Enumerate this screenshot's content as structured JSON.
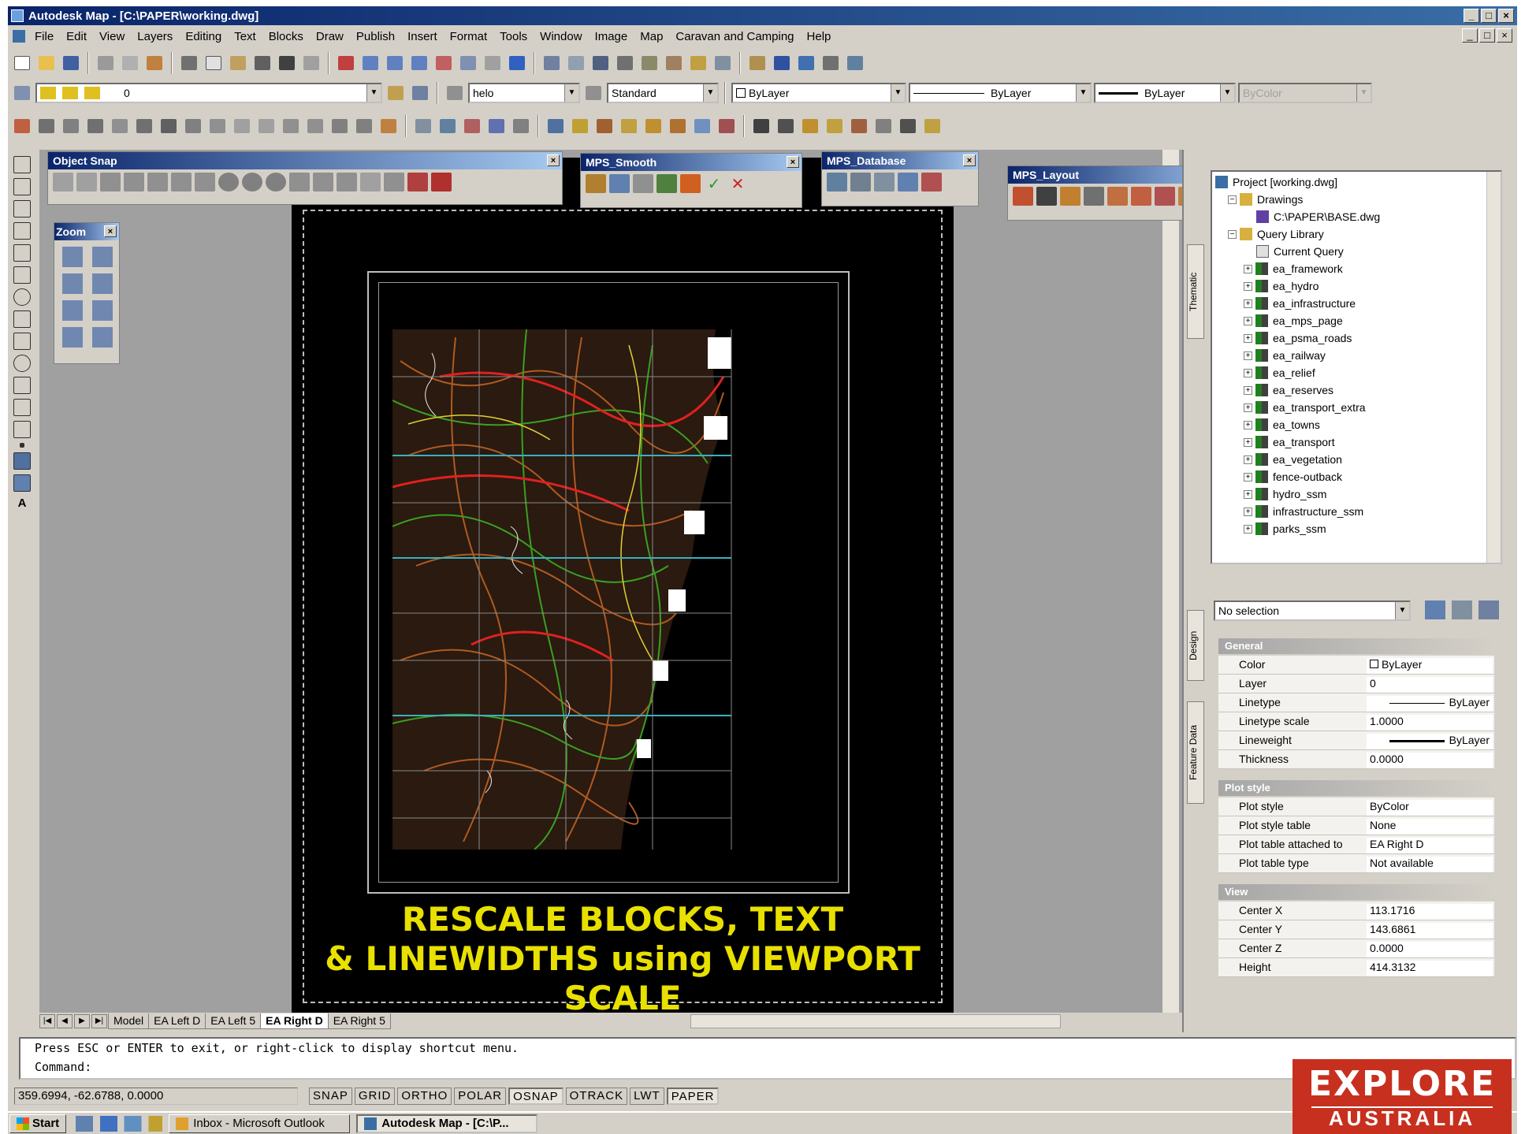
{
  "window": {
    "title": "Autodesk Map - [C:\\PAPER\\working.dwg]",
    "min": "_",
    "max": "□",
    "close": "×"
  },
  "menu": [
    "File",
    "Edit",
    "View",
    "Layers",
    "Editing",
    "Text",
    "Blocks",
    "Draw",
    "Publish",
    "Insert",
    "Format",
    "Tools",
    "Window",
    "Image",
    "Map",
    "Caravan and Camping",
    "Help"
  ],
  "layer_combo": "0",
  "text_style_combo": "helo",
  "dim_style_combo": "Standard",
  "color_combo": "ByLayer",
  "linetype_combo": "ByLayer",
  "lineweight_combo": "ByLayer",
  "plotstyle_combo": "ByColor",
  "palettes": {
    "object_snap": "Object Snap",
    "zoom": "Zoom",
    "smooth": "MPS_Smooth",
    "database": "MPS_Database",
    "layout": "MPS_Layout"
  },
  "slogan": [
    "RESCALE BLOCKS, TEXT",
    "& LINEWIDTHS using VIEWPORT",
    "SCALE"
  ],
  "layout_tabs": [
    "Model",
    "EA Left D",
    "EA Left 5",
    "EA Right D",
    "EA Right 5"
  ],
  "active_tab": "EA Right D",
  "workspace": {
    "vtab_thematic": "Thematic",
    "project": "Project [working.dwg]",
    "drawings": "Drawings",
    "drawing_file": "C:\\PAPER\\BASE.dwg",
    "query_library": "Query Library",
    "current_query": "Current Query",
    "queries": [
      "ea_framework",
      "ea_hydro",
      "ea_infrastructure",
      "ea_mps_page",
      "ea_psma_roads",
      "ea_railway",
      "ea_relief",
      "ea_reserves",
      "ea_transport_extra",
      "ea_towns",
      "ea_transport",
      "ea_vegetation",
      "fence-outback",
      "hydro_ssm",
      "infrastructure_ssm",
      "parks_ssm"
    ]
  },
  "properties": {
    "vtab_design": "Design",
    "vtab_feature": "Feature Data",
    "selection": "No selection",
    "general": "General",
    "general_rows": [
      [
        "Color",
        "ByLayer"
      ],
      [
        "Layer",
        "0"
      ],
      [
        "Linetype",
        "ByLayer"
      ],
      [
        "Linetype scale",
        "1.0000"
      ],
      [
        "Lineweight",
        "ByLayer"
      ],
      [
        "Thickness",
        "0.0000"
      ]
    ],
    "plot": "Plot style",
    "plot_rows": [
      [
        "Plot style",
        "ByColor"
      ],
      [
        "Plot style table",
        "None"
      ],
      [
        "Plot table attached to",
        "EA Right D"
      ],
      [
        "Plot table type",
        "Not available"
      ]
    ],
    "view": "View",
    "view_rows": [
      [
        "Center X",
        "113.1716"
      ],
      [
        "Center Y",
        "143.6861"
      ],
      [
        "Center Z",
        "0.0000"
      ],
      [
        "Height",
        "414.3132"
      ]
    ]
  },
  "command": {
    "line1": "Press ESC or ENTER to exit, or right-click to display shortcut menu.",
    "line2": "Command:"
  },
  "status": {
    "coords": "359.6994, -62.6788, 0.0000",
    "toggles": [
      "SNAP",
      "GRID",
      "ORTHO",
      "POLAR",
      "OSNAP",
      "OTRACK",
      "LWT",
      "PAPER"
    ]
  },
  "taskbar": {
    "start": "Start",
    "task1": "Inbox - Microsoft Outlook",
    "task2": "Autodesk Map - [C:\\P..."
  },
  "brand": {
    "line1": "EXPLORE",
    "line2": "AUSTRALIA"
  }
}
